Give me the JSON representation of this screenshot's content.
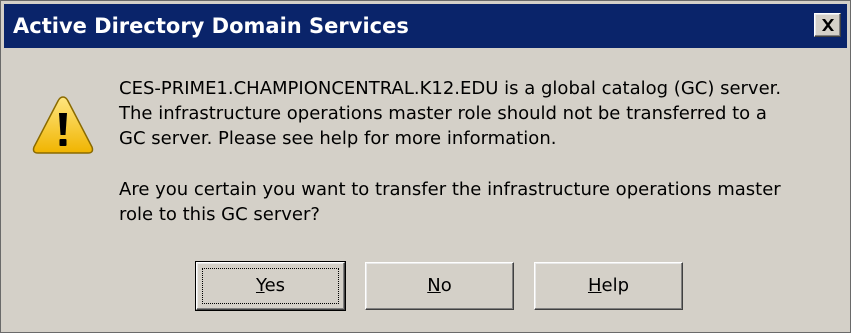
{
  "window": {
    "title": "Active Directory Domain Services"
  },
  "icons": {
    "warning": "warning-icon",
    "close": "close-icon"
  },
  "message": {
    "line1": "CES-PRIME1.CHAMPIONCENTRAL.K12.EDU is a global catalog (GC) server.",
    "line2": "The infrastructure operations master role should not be transferred to a",
    "line3": "GC server. Please see help for more information.",
    "line4": "Are you certain you want to transfer the infrastructure operations master",
    "line5": "role to this GC server?"
  },
  "buttons": {
    "yes": {
      "mnemonic": "Y",
      "rest": "es"
    },
    "no": {
      "mnemonic": "N",
      "rest": "o"
    },
    "help": {
      "mnemonic": "H",
      "rest": "elp"
    }
  },
  "colors": {
    "titlebar": "#0a246a",
    "face": "#d4d0c8",
    "warning_fill": "#f5c518"
  }
}
